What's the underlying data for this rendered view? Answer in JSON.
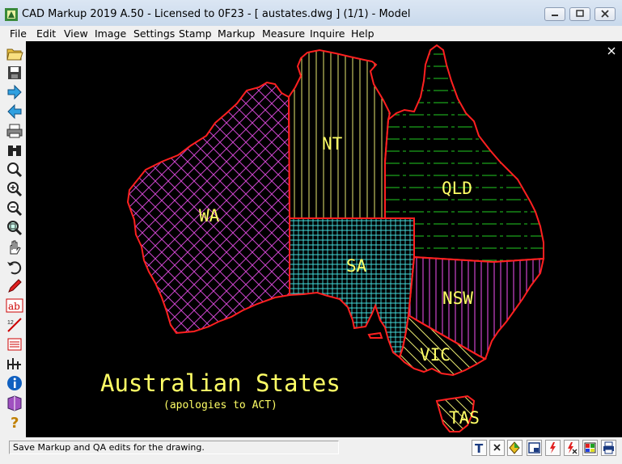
{
  "window": {
    "title": "CAD Markup 2019 A.50 - Licensed to 0F23  -  [ austates.dwg ] (1/1)  -  Model"
  },
  "menu": [
    "File",
    "Edit",
    "View",
    "Image",
    "Settings",
    "Stamp",
    "Markup",
    "Measure",
    "Inquire",
    "Help"
  ],
  "toolbar": {
    "tools": [
      "open-folder-icon",
      "save-icon",
      "next-arrow-icon",
      "back-arrow-icon",
      "print-icon",
      "binoculars-icon",
      "zoom-icon",
      "zoom-in-icon",
      "zoom-out-icon",
      "zoom-window-icon",
      "pan-hand-icon",
      "undo-icon",
      "pencil-icon",
      "text-ab-icon",
      "dimension-icon",
      "layers-icon",
      "measure-icon",
      "info-icon",
      "book-icon",
      "help-icon"
    ]
  },
  "drawing": {
    "title": "Australian States",
    "subtitle": "(apologies to ACT)",
    "states": {
      "wa": "WA",
      "nt": "NT",
      "qld": "QLD",
      "sa": "SA",
      "nsw": "NSW",
      "vic": "VIC",
      "tas": "TAS"
    },
    "colors": {
      "outline": "#ff2020",
      "wa": "#cc44cc",
      "nt": "#e8e870",
      "qld": "#22cc22",
      "sa": "#44dddd",
      "nsw": "#cc44cc",
      "vic": "#e8e870",
      "text": "#ffff66"
    }
  },
  "status": {
    "message": "Save Markup and QA edits for the drawing."
  },
  "status_buttons": [
    "text-t-icon",
    "close-x-icon",
    "layer-color-icon",
    "window-icon",
    "lightning-icon",
    "lightning-x-icon",
    "color-palette-icon",
    "printer-icon"
  ]
}
